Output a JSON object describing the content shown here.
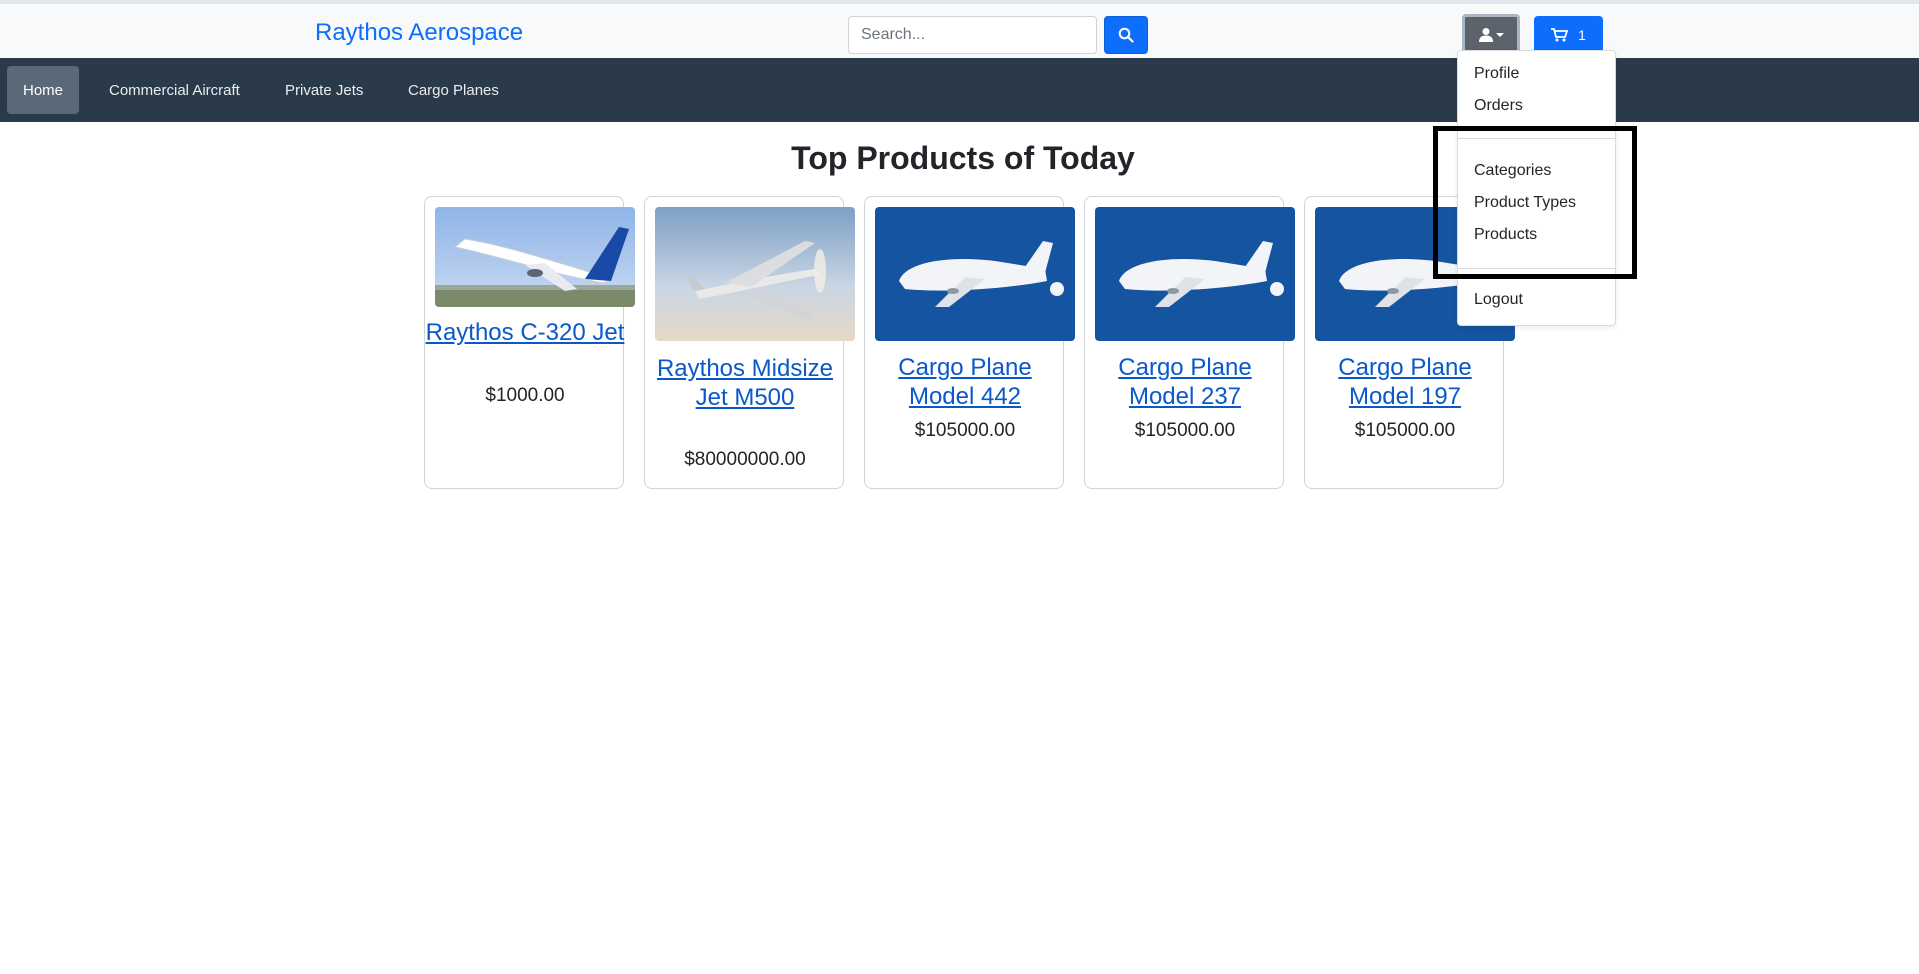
{
  "header": {
    "brand": "Raythos Aerospace",
    "search_placeholder": "Search...",
    "cart_count": "1"
  },
  "nav": {
    "items": [
      {
        "label": "Home",
        "active": true
      },
      {
        "label": "Commercial Aircraft",
        "active": false
      },
      {
        "label": "Private Jets",
        "active": false
      },
      {
        "label": "Cargo Planes",
        "active": false
      }
    ]
  },
  "main": {
    "heading": "Top Products of Today",
    "products": [
      {
        "title": "Raythos C-320 Jet",
        "price": "$1000.00"
      },
      {
        "title": "Raythos Midsize Jet M500",
        "price": "$80000000.00"
      },
      {
        "title": "Cargo Plane Model 442",
        "price": "$105000.00"
      },
      {
        "title": "Cargo Plane Model 237",
        "price": "$105000.00"
      },
      {
        "title": "Cargo Plane Model 197",
        "price": "$105000.00"
      }
    ]
  },
  "user_menu": {
    "items": [
      "Profile",
      "Orders",
      "Categories",
      "Product Types",
      "Products",
      "Logout"
    ]
  },
  "colors": {
    "brand": "#0d6efd",
    "navbar": "#2b3a4a",
    "link": "#0a58ca"
  },
  "icons": [
    "search-icon",
    "user-icon",
    "caret-down-icon",
    "cart-icon"
  ]
}
